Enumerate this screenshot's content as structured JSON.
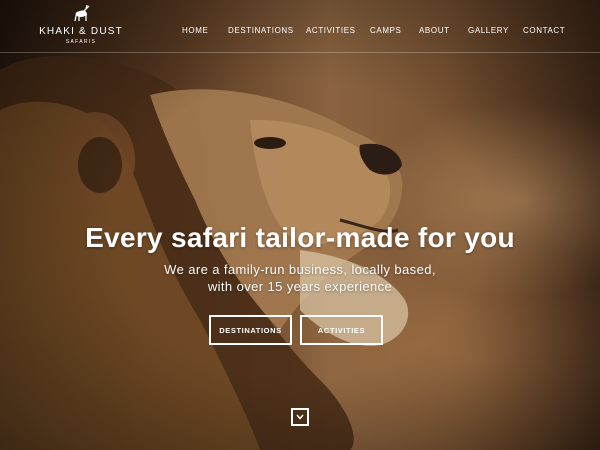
{
  "brand": {
    "name": "KHAKI & DUST",
    "tagline": "SAFARIS",
    "logo_icon": "antelope-icon"
  },
  "nav": {
    "items": [
      {
        "label": "HOME"
      },
      {
        "label": "DESTINATIONS"
      },
      {
        "label": "ACTIVITIES"
      },
      {
        "label": "CAMPS"
      },
      {
        "label": "ABOUT"
      },
      {
        "label": "GALLERY"
      },
      {
        "label": "CONTACT"
      }
    ]
  },
  "hero": {
    "background": "lion-photo",
    "headline": "Every safari tailor-made for you",
    "subline_1": "We are a family-run business, locally based,",
    "subline_2": "with over 15 years experience",
    "buttons": {
      "destinations": "DESTINATIONS",
      "activities": "ACTIVITIES"
    },
    "scroll_icon": "chevron-down-icon"
  },
  "colors": {
    "text": "#ffffff",
    "background_dark": "#2a1a0f",
    "background_warm": "#8a6340"
  }
}
